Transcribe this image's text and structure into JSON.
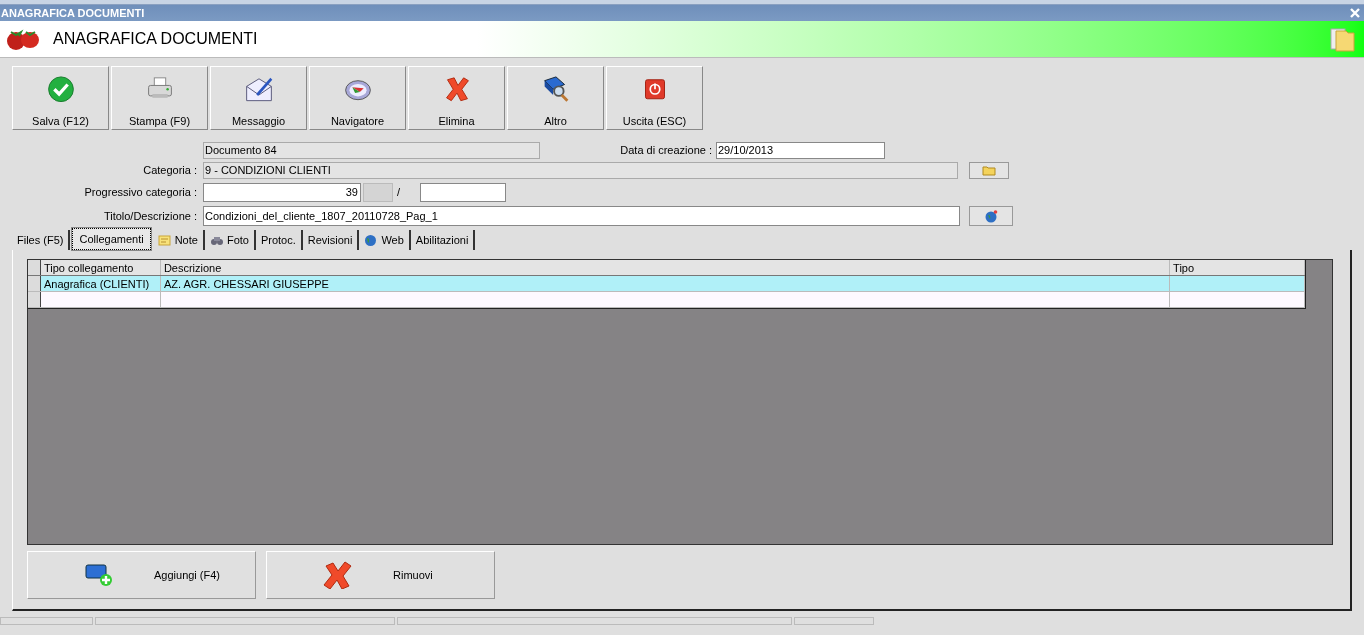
{
  "window": {
    "title": "ANAGRAFICA DOCUMENTI"
  },
  "header": {
    "title": "ANAGRAFICA DOCUMENTI"
  },
  "toolbar": [
    {
      "label": "Salva (F12)"
    },
    {
      "label": "Stampa (F9)"
    },
    {
      "label": "Messaggio"
    },
    {
      "label": "Navigatore"
    },
    {
      "label": "Elimina"
    },
    {
      "label": "Altro"
    },
    {
      "label": "Uscita (ESC)"
    }
  ],
  "form": {
    "documento": "Documento 84",
    "data_label": "Data di creazione :",
    "data_value": "29/10/2013",
    "categoria_label": "Categoria :",
    "categoria_value": "9 - CONDIZIONI CLIENTI",
    "progressivo_label": "Progressivo categoria :",
    "progressivo_value": "39",
    "separator": "/",
    "titolo_label": "Titolo/Descrizione :",
    "titolo_value": "Condizioni_del_cliente_1807_20110728_Pag_1"
  },
  "tabs": [
    {
      "label": "Files (F5)",
      "selected": false
    },
    {
      "label": "Collegamenti",
      "selected": true
    },
    {
      "label": "Note",
      "selected": false
    },
    {
      "label": "Foto",
      "selected": false
    },
    {
      "label": "Protoc.",
      "selected": false
    },
    {
      "label": "Revisioni",
      "selected": false
    },
    {
      "label": "Web",
      "selected": false
    },
    {
      "label": "Abilitazioni",
      "selected": false
    }
  ],
  "table": {
    "columns": [
      "Tipo collegamento",
      "Descrizione",
      "Tipo"
    ],
    "rows": [
      {
        "cells": [
          "Anagrafica (CLIENTI)",
          "AZ. AGR. CHESSARI GIUSEPPE"
        ],
        "selected": true
      }
    ]
  },
  "actions": [
    {
      "label": "Aggiungi (F4)"
    },
    {
      "label": "Rimuovi"
    }
  ]
}
